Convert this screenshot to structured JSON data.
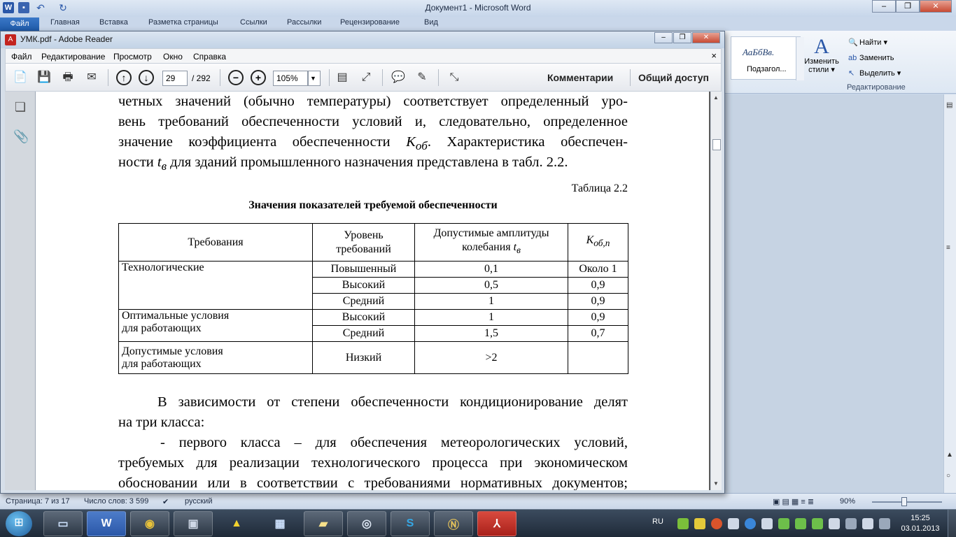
{
  "word": {
    "title": "Документ1 - Microsoft Word",
    "file_tab": "Файл",
    "tabs": [
      "Главная",
      "Вставка",
      "Разметка страницы",
      "Ссылки",
      "Рассылки",
      "Рецензирование",
      "Вид"
    ],
    "styles_sample": "АаБбВв.",
    "styles_name": "Подзагол...",
    "change_styles": "Изменить",
    "change_styles_line2": "стили",
    "find": "Найти",
    "replace": "Заменить",
    "select": "Выделить",
    "editing_group": "Редактирование",
    "status_page": "Страница: 7 из 17",
    "status_words": "Число слов: 3 599",
    "status_lang": "русский",
    "zoom": "90%"
  },
  "reader": {
    "title": "УМК.pdf - Adobe Reader",
    "menu": [
      "Файл",
      "Редактирование",
      "Просмотр",
      "Окно",
      "Справка"
    ],
    "page_current": "29",
    "page_total": "/ 292",
    "zoom": "105%",
    "comments_btn": "Комментарии",
    "share_btn": "Общий доступ"
  },
  "document": {
    "para1_lines": [
      "четных значений (обычно температуры) соответствует определенный уро-",
      "вень требований обеспеченности условий и, следовательно, определенное"
    ],
    "para1_line3_a": "значение коэффициента обеспеченности ",
    "para1_line3_sym": "K",
    "para1_line3_sub": "об",
    "para1_line3_b": ". Характеристика обеспечен-",
    "para1_line4_a": "ности ",
    "para1_line4_sym": "t",
    "para1_line4_sub": "в",
    "para1_line4_b": " для зданий промышленного назначения представлена в табл. 2.2.",
    "table_number": "Таблица 2.2",
    "table_title": "Значения показателей требуемой обеспеченности",
    "table_headers": {
      "requirements": "Требования",
      "level_1": "Уровень",
      "level_2": "требований",
      "ampl_1": "Допустимые амплитуды",
      "ampl_2": "колебания ",
      "ampl_sym": "t",
      "ampl_sub": "в",
      "k_sym": "K",
      "k_sub": "об,п"
    },
    "table_rows": [
      {
        "req": "Технологические",
        "level": "Повышенный",
        "ampl": "0,1",
        "k": "Около 1"
      },
      {
        "level": "Высокий",
        "ampl": "0,5",
        "k": "0,9"
      },
      {
        "level": "Средний",
        "ampl": "1",
        "k": "0,9"
      },
      {
        "req_1": "Оптимальные условия",
        "req_2": "для работающих",
        "level": "Высокий",
        "ampl": "1",
        "k": "0,9"
      },
      {
        "level": "Средний",
        "ampl": "1,5",
        "k": "0,7"
      },
      {
        "req_1": "Допустимые условия",
        "req_2": "для работающих",
        "level": "Низкий",
        "ampl": ">2",
        "k": ""
      }
    ],
    "para2_lines": [
      "В зависимости от степени обеспеченности кондиционирование делят",
      "на три класса:",
      "-   первого класса – для обеспечения метеорологических условий,",
      "требуемых для реализации технологического процесса при экономическом",
      "обосновании или в соответствии с требованиями нормативных документов;"
    ]
  },
  "taskbar": {
    "lang": "RU",
    "time": "15:25",
    "date": "03.01.2013"
  }
}
